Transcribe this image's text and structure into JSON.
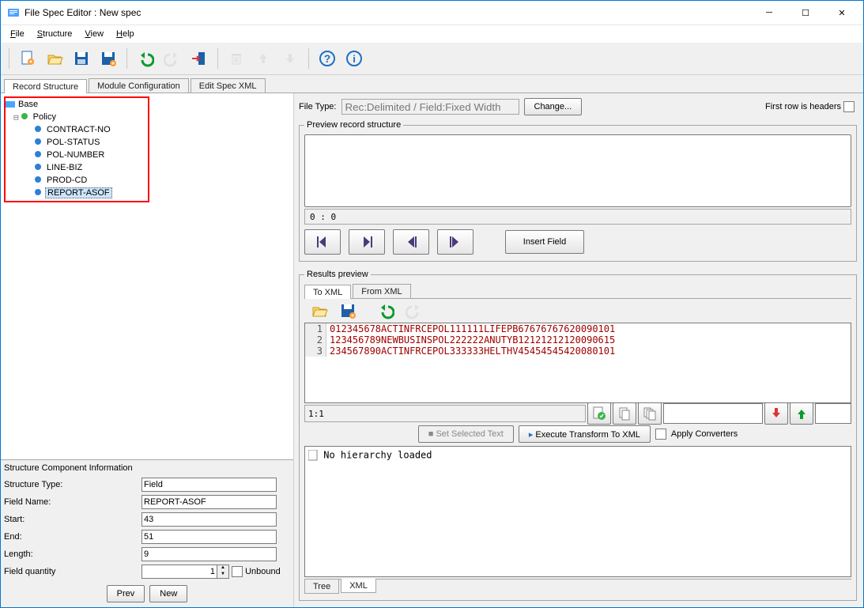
{
  "title": "File Spec Editor : New spec",
  "menu": {
    "file": "File",
    "structure": "Structure",
    "view": "View",
    "help": "Help"
  },
  "tabs": {
    "record_structure": "Record Structure",
    "module_cfg": "Module Configuration",
    "edit_xml": "Edit Spec XML"
  },
  "tree": {
    "root": "Base",
    "nodes": [
      {
        "label": "Policy",
        "children": [
          {
            "label": "CONTRACT-NO"
          },
          {
            "label": "POL-STATUS"
          },
          {
            "label": "POL-NUMBER"
          },
          {
            "label": "LINE-BIZ"
          },
          {
            "label": "PROD-CD"
          },
          {
            "label": "REPORT-ASOF",
            "selected": true
          }
        ]
      }
    ]
  },
  "struct_info": {
    "heading": "Structure Component Information",
    "type_lbl": "Structure Type:",
    "type_val": "Field",
    "name_lbl": "Field Name:",
    "name_val": "REPORT-ASOF",
    "start_lbl": "Start:",
    "start_val": "43",
    "end_lbl": "End:",
    "end_val": "51",
    "length_lbl": "Length:",
    "length_val": "9",
    "qty_lbl": "Field quantity",
    "qty_val": "1",
    "unbound": "Unbound",
    "prev": "Prev",
    "new": "New"
  },
  "filetype": {
    "label": "File Type:",
    "value": "Rec:Delimited / Field:Fixed Width",
    "change": "Change...",
    "first_row": "First row is headers"
  },
  "preview": {
    "legend": "Preview record structure",
    "counter": "0 : 0",
    "insert": "Insert Field"
  },
  "results": {
    "legend": "Results preview",
    "tabs": {
      "toxml": "To XML",
      "fromxml": "From XML"
    },
    "lines": [
      "012345678ACTINFRCEPOL111111LIFEPB67676767620090101",
      "123456789NEWBUSINSPOL222222ANUTYB12121212120090615",
      "234567890ACTINFRCEPOL333333HELTHV45454545420080101"
    ],
    "crumb": "1:1",
    "set_selected": "Set Selected Text",
    "exec": "Execute Transform To XML",
    "apply_conv": "Apply Converters",
    "no_hier": "No hierarchy loaded",
    "bottom_tabs": {
      "tree": "Tree",
      "xml": "XML"
    }
  }
}
